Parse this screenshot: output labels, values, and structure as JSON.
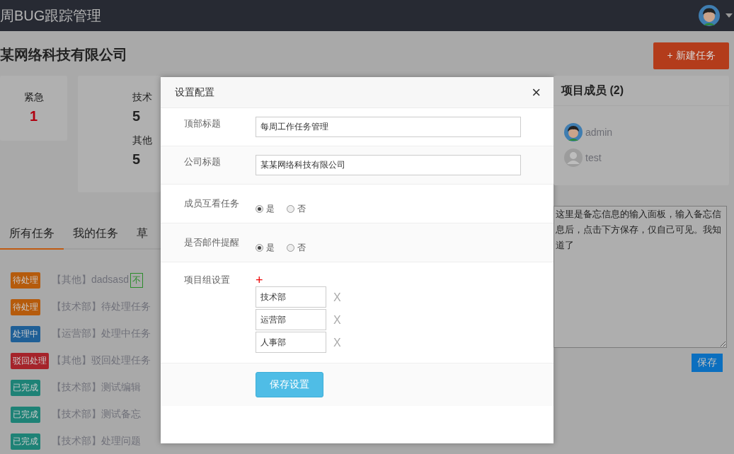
{
  "header": {
    "title": "周BUG跟踪管理"
  },
  "company_title": "某网络科技有限公司",
  "stat_cards": [
    {
      "items": [
        {
          "label": "紧急",
          "value": "1",
          "urgent": true
        }
      ]
    },
    {
      "items": [
        {
          "label": "技术",
          "value": "5",
          "urgent": false
        },
        {
          "label": "其他",
          "value": "5",
          "urgent": false
        }
      ]
    }
  ],
  "tabs": [
    {
      "label": "所有任务",
      "selected": true
    },
    {
      "label": "我的任务",
      "selected": false
    },
    {
      "label": "草",
      "selected": false
    }
  ],
  "tasks": [
    {
      "status": "待处理",
      "color": "#b55b0c",
      "title": "【其他】dadsasd",
      "tag": {
        "text": "不",
        "color": "#2b8c2b"
      }
    },
    {
      "status": "待处理",
      "color": "#b55b0c",
      "title": "【技术部】待处理任务"
    },
    {
      "status": "处理中",
      "color": "#1f5f96",
      "title": "【运营部】处理中任务"
    },
    {
      "status": "驳回处理",
      "color": "#a5232a",
      "title": "【其他】驳回处理任务"
    },
    {
      "status": "已完成",
      "color": "#1e8276",
      "title": "【技术部】测试编辑"
    },
    {
      "status": "已完成",
      "color": "#1e8276",
      "title": "【技术部】测试备忘"
    },
    {
      "status": "已完成",
      "color": "#1e8276",
      "title": "【技术部】处理问题"
    }
  ],
  "settings_dialog": {
    "title": "设置配置",
    "close": "×",
    "fields": [
      {
        "kind": "text",
        "label": "顶部标题",
        "value": "每周工作任务管理"
      },
      {
        "kind": "text",
        "label": "公司标题",
        "value": "某某网络科技有限公司"
      },
      {
        "kind": "radio",
        "label": "成员互看任务",
        "options": [
          {
            "label": "是",
            "selected": true
          },
          {
            "label": "否",
            "selected": false
          }
        ]
      },
      {
        "kind": "radio",
        "label": "是否邮件提醒",
        "options": [
          {
            "label": "是",
            "selected": true
          },
          {
            "label": "否",
            "selected": false
          }
        ]
      },
      {
        "kind": "groups",
        "label": "项目组设置",
        "add": "+",
        "groups": [
          {
            "value": "技术部",
            "remove": "X"
          },
          {
            "value": "运营部",
            "remove": "X"
          },
          {
            "value": "人事部",
            "remove": "X"
          }
        ]
      }
    ],
    "save_button": "保存设置"
  },
  "new_task_button": "+ 新建任务",
  "members_panel": {
    "title": "项目成员 (2)",
    "members": [
      {
        "name": "admin",
        "kind": "cartoon"
      },
      {
        "name": "test",
        "kind": "default"
      }
    ]
  },
  "memo": {
    "value": "这里是备忘信息的输入面板，输入备忘信息后，点击下方保存，仅自己可见。我知道了",
    "save_button": "保存"
  }
}
